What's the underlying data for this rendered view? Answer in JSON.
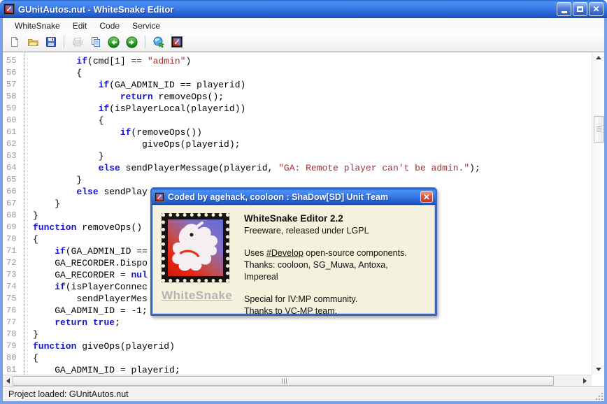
{
  "window": {
    "title": "GUnitAutos.nut - WhiteSnake Editor"
  },
  "window_controls": {
    "minimize": "minimize",
    "maximize": "maximize",
    "close": "close"
  },
  "menu": {
    "items": [
      "WhiteSnake",
      "Edit",
      "Code",
      "Service"
    ]
  },
  "toolbar": {
    "icons": [
      "new-file",
      "open-file",
      "save-file",
      "print",
      "copy",
      "navigate-back",
      "navigate-forward",
      "web",
      "about-stamp"
    ]
  },
  "editor": {
    "syntax": {
      "keywords": [
        "if",
        "else",
        "return",
        "function",
        "true",
        "null",
        "nul"
      ],
      "keyword_color": "#1414C8",
      "string_color": "#A33030",
      "text_color": "#000000"
    },
    "lines": [
      {
        "n": "55",
        "c": "        if(cmd[1] == \"admin\")"
      },
      {
        "n": "56",
        "c": "        {"
      },
      {
        "n": "57",
        "c": "            if(GA_ADMIN_ID == playerid)"
      },
      {
        "n": "58",
        "c": "                return removeOps();"
      },
      {
        "n": "59",
        "c": "            if(isPlayerLocal(playerid))"
      },
      {
        "n": "60",
        "c": "            {"
      },
      {
        "n": "61",
        "c": "                if(removeOps())"
      },
      {
        "n": "62",
        "c": "                    giveOps(playerid);"
      },
      {
        "n": "63",
        "c": "            }"
      },
      {
        "n": "64",
        "c": "            else sendPlayerMessage(playerid, \"GA: Remote player can't be admin.\");"
      },
      {
        "n": "65",
        "c": "        }"
      },
      {
        "n": "66",
        "c": "        else sendPlay"
      },
      {
        "n": "67",
        "c": "    }"
      },
      {
        "n": "68",
        "c": "}"
      },
      {
        "n": "69",
        "c": "function removeOps()"
      },
      {
        "n": "70",
        "c": "{"
      },
      {
        "n": "71",
        "c": "    if(GA_ADMIN_ID =="
      },
      {
        "n": "72",
        "c": "    GA_RECORDER.Dispo"
      },
      {
        "n": "73",
        "c": "    GA_RECORDER = nul"
      },
      {
        "n": "74",
        "c": "    if(isPlayerConnec"
      },
      {
        "n": "75",
        "c": "        sendPlayerMes"
      },
      {
        "n": "76",
        "c": "    GA_ADMIN_ID = -1;"
      },
      {
        "n": "77",
        "c": "    return true;"
      },
      {
        "n": "78",
        "c": "}"
      },
      {
        "n": "79",
        "c": "function giveOps(playerid)"
      },
      {
        "n": "80",
        "c": "{"
      },
      {
        "n": "81",
        "c": "    GA_ADMIN_ID = playerid;"
      }
    ]
  },
  "dialog": {
    "title": "Coded by agehack, cooloon : ShaDow[SD] Unit Team",
    "app_title": "WhiteSnake Editor 2.2",
    "license": "Freeware, released under LGPL",
    "uses_prefix": "Uses ",
    "uses_link": "#Develop",
    "uses_suffix": " open-source components.",
    "thanks_line1": "Thanks: cooloon, SG_Muwa, Antoxa,",
    "thanks_line2": "Impereal",
    "special_line1": "Special for IV:MP community.",
    "special_line2": "Thanks to VC-MP team.",
    "stamp_label": "WhiteSnake",
    "close_glyph": "✕"
  },
  "status": {
    "text": "Project loaded: GUnitAutos.nut"
  },
  "colors": {
    "titlebar_blue": "#3B7BE8",
    "frame_blue": "#7AA1E6",
    "dialog_bg": "#F4F2DC",
    "close_red": "#D9573C",
    "keyword_blue": "#1414C8",
    "string_red": "#A33030"
  }
}
